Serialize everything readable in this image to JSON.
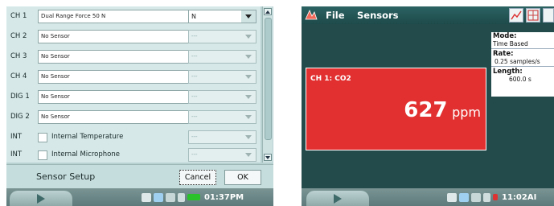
{
  "left": {
    "rows": [
      {
        "channel": "CH 1",
        "sensor": "Dual Range Force 50 N",
        "unit": "N"
      },
      {
        "channel": "CH 2",
        "sensor": "No Sensor",
        "unit": "---"
      },
      {
        "channel": "CH 3",
        "sensor": "No Sensor",
        "unit": "---"
      },
      {
        "channel": "CH 4",
        "sensor": "No Sensor",
        "unit": "---"
      },
      {
        "channel": "DIG 1",
        "sensor": "No Sensor",
        "unit": "---"
      },
      {
        "channel": "DIG 2",
        "sensor": "No Sensor",
        "unit": "---"
      }
    ],
    "internal": [
      {
        "channel": "INT",
        "label": "Internal Temperature",
        "unit": "---"
      },
      {
        "channel": "INT",
        "label": "Internal Microphone",
        "unit": "---"
      }
    ],
    "footer": {
      "title": "Sensor Setup",
      "cancel": "Cancel",
      "ok": "OK"
    },
    "taskbar": {
      "clock": "01:37PM"
    }
  },
  "right": {
    "menu": {
      "file": "File",
      "sensors": "Sensors"
    },
    "meter": {
      "label": "CH 1: CO2",
      "value": "627",
      "unit": "ppm"
    },
    "info": {
      "mode_label": "Mode:",
      "mode_value": "Time Based",
      "rate_label": "Rate:",
      "rate_value": "0.25 samples/s",
      "length_label": "Length:",
      "length_value": "600.0 s"
    },
    "taskbar": {
      "clock": "11:02AI"
    }
  },
  "colors": {
    "meter_bg": "#e23030",
    "screen_bg": "#234b4b",
    "dialog_bg": "#d6e8e8"
  }
}
